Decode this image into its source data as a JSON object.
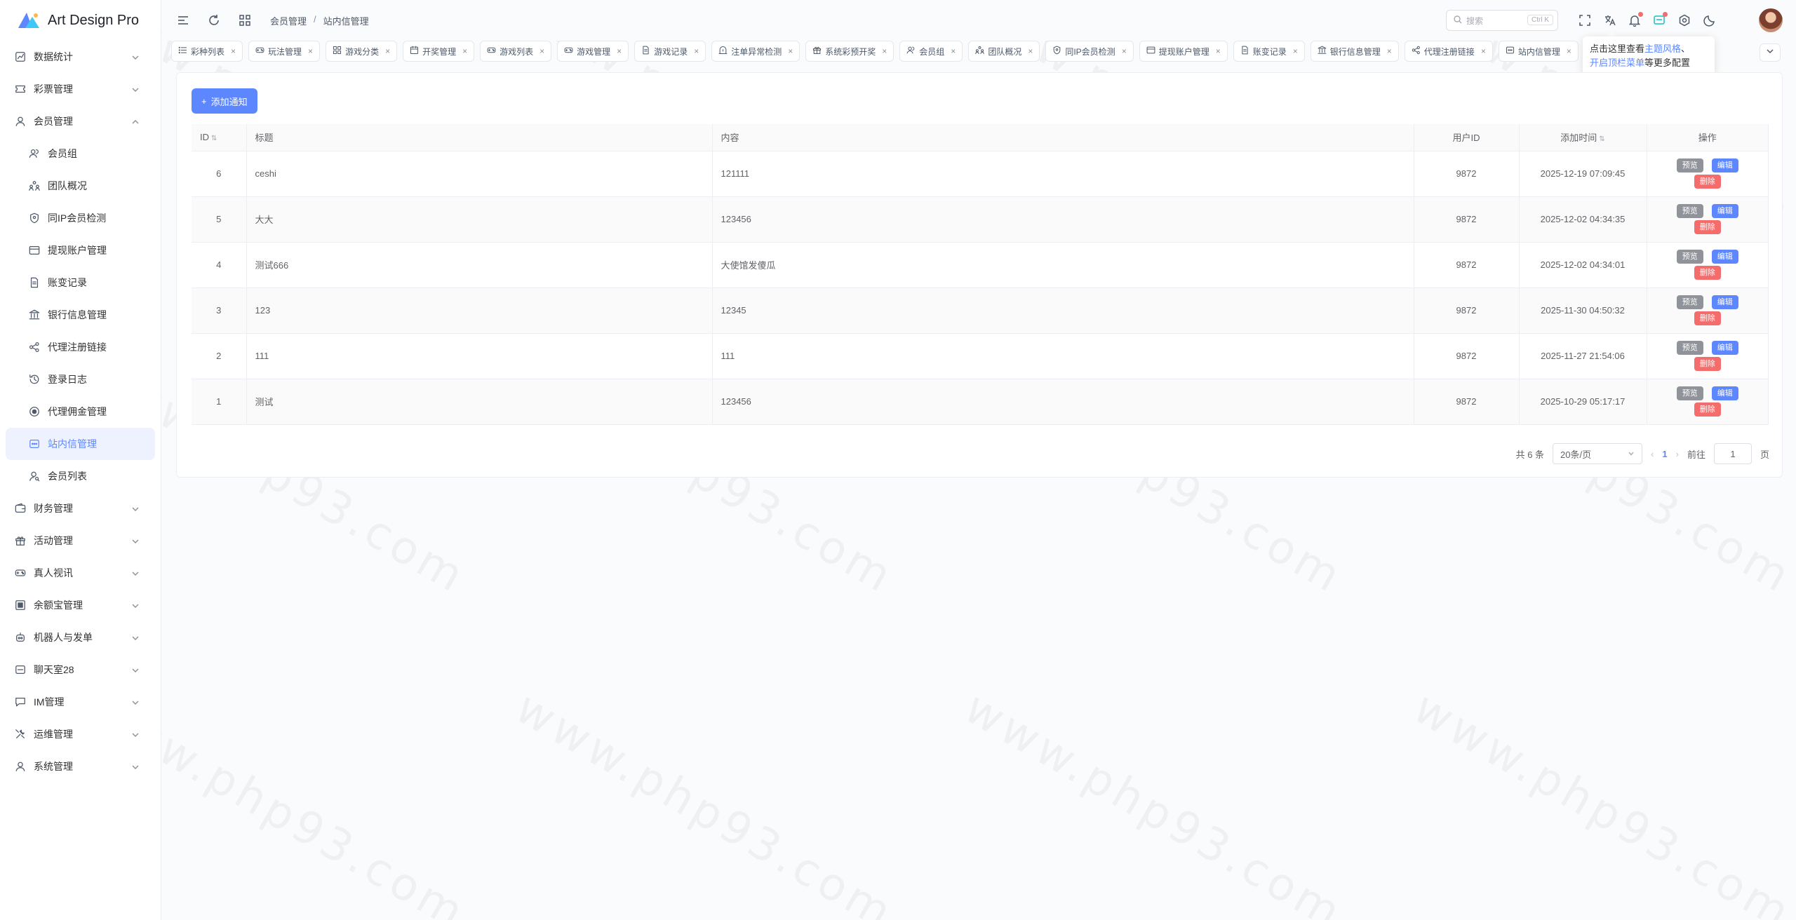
{
  "app": {
    "title": "Art Design Pro",
    "brand_color": "#5d87ff"
  },
  "sidebar": {
    "items": [
      {
        "label": "数据统计",
        "icon": "chart-icon",
        "expandable": true
      },
      {
        "label": "彩票管理",
        "icon": "ticket-icon",
        "expandable": true
      },
      {
        "label": "会员管理",
        "icon": "user-icon",
        "expandable": true,
        "expanded": true
      },
      {
        "label": "会员组",
        "icon": "users-icon",
        "sub": true
      },
      {
        "label": "团队概况",
        "icon": "team-icon",
        "sub": true
      },
      {
        "label": "同IP会员检测",
        "icon": "shield-icon",
        "sub": true
      },
      {
        "label": "提现账户管理",
        "icon": "card-icon",
        "sub": true
      },
      {
        "label": "账变记录",
        "icon": "document-icon",
        "sub": true
      },
      {
        "label": "银行信息管理",
        "icon": "bank-icon",
        "sub": true
      },
      {
        "label": "代理注册链接",
        "icon": "share-icon",
        "sub": true
      },
      {
        "label": "登录日志",
        "icon": "history-icon",
        "sub": true
      },
      {
        "label": "代理佣金管理",
        "icon": "coin-icon",
        "sub": true
      },
      {
        "label": "站内信管理",
        "icon": "message-icon",
        "sub": true,
        "active": true
      },
      {
        "label": "会员列表",
        "icon": "user-search-icon",
        "sub": true
      },
      {
        "label": "财务管理",
        "icon": "wallet-icon",
        "expandable": true
      },
      {
        "label": "活动管理",
        "icon": "gift-icon",
        "expandable": true
      },
      {
        "label": "真人视讯",
        "icon": "gamepad-icon",
        "expandable": true
      },
      {
        "label": "余额宝管理",
        "icon": "safe-icon",
        "expandable": true
      },
      {
        "label": "机器人与发单",
        "icon": "robot-icon",
        "expandable": true
      },
      {
        "label": "聊天室28",
        "icon": "chat-icon",
        "expandable": true
      },
      {
        "label": "IM管理",
        "icon": "comment-icon",
        "expandable": true
      },
      {
        "label": "运维管理",
        "icon": "tools-icon",
        "expandable": true
      },
      {
        "label": "系统管理",
        "icon": "user-icon",
        "expandable": true
      }
    ]
  },
  "header": {
    "breadcrumb": [
      "会员管理",
      "站内信管理"
    ],
    "search_placeholder": "搜索",
    "search_shortcut": "Ctrl K"
  },
  "tabs": [
    {
      "label": "彩种列表",
      "icon": "list-icon"
    },
    {
      "label": "玩法管理",
      "icon": "gamepad-icon"
    },
    {
      "label": "游戏分类",
      "icon": "grid-icon"
    },
    {
      "label": "开奖管理",
      "icon": "calendar-icon"
    },
    {
      "label": "游戏列表",
      "icon": "gamepad-icon"
    },
    {
      "label": "游戏管理",
      "icon": "gamepad-icon"
    },
    {
      "label": "游戏记录",
      "icon": "document-icon"
    },
    {
      "label": "注单异常检测",
      "icon": "alert-icon"
    },
    {
      "label": "系统彩预开奖",
      "icon": "gift-icon"
    },
    {
      "label": "会员组",
      "icon": "users-icon"
    },
    {
      "label": "团队概况",
      "icon": "team-icon"
    },
    {
      "label": "同IP会员检测",
      "icon": "shield-icon"
    },
    {
      "label": "提现账户管理",
      "icon": "card-icon"
    },
    {
      "label": "账变记录",
      "icon": "document-icon"
    },
    {
      "label": "银行信息管理",
      "icon": "bank-icon"
    },
    {
      "label": "代理注册链接",
      "icon": "share-icon"
    },
    {
      "label": "站内信管理",
      "icon": "message-icon"
    }
  ],
  "tooltip": {
    "line1_prefix": "点击这里查看",
    "line1_link": "主题风格",
    "line1_suffix": "、",
    "line2_link": "开启顶栏菜单",
    "line2_suffix": "等更多配置"
  },
  "toolbar": {
    "add_label": "添加通知"
  },
  "table": {
    "headers": {
      "id": "ID",
      "title": "标题",
      "content": "内容",
      "user_id": "用户ID",
      "time": "添加时间",
      "ops": "操作"
    },
    "rows": [
      {
        "id": "6",
        "title": "ceshi",
        "content": "121111",
        "user_id": "9872",
        "time": "2025-12-19 07:09:45"
      },
      {
        "id": "5",
        "title": "大大",
        "content": "123456",
        "user_id": "9872",
        "time": "2025-12-02 04:34:35"
      },
      {
        "id": "4",
        "title": "测试666",
        "content": "大使馆发傻瓜",
        "user_id": "9872",
        "time": "2025-12-02 04:34:01"
      },
      {
        "id": "3",
        "title": "123",
        "content": "12345",
        "user_id": "9872",
        "time": "2025-11-30 04:50:32"
      },
      {
        "id": "2",
        "title": "111",
        "content": "111",
        "user_id": "9872",
        "time": "2025-11-27 21:54:06"
      },
      {
        "id": "1",
        "title": "测试",
        "content": "123456",
        "user_id": "9872",
        "time": "2025-10-29 05:17:17"
      }
    ],
    "op_labels": {
      "preview": "预览",
      "edit": "编辑",
      "delete": "删除"
    }
  },
  "pager": {
    "total": "共 6 条",
    "page_size": "20条/页",
    "current": "1",
    "goto_label": "前往",
    "goto_value": "1",
    "page_suffix": "页"
  },
  "watermark": "www.php93.com"
}
